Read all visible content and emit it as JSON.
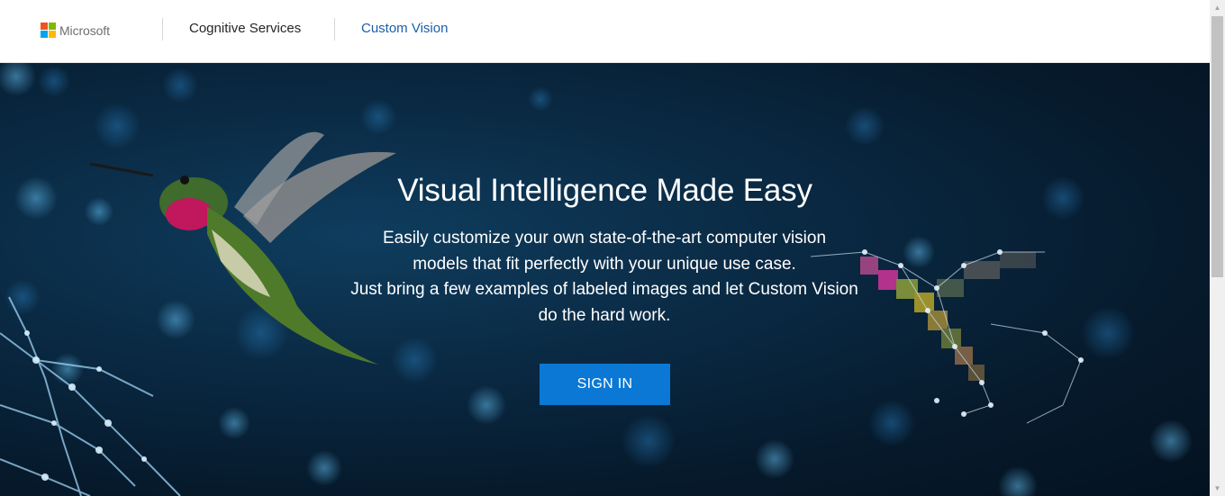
{
  "header": {
    "brand": "Microsoft",
    "nav": [
      {
        "label": "Cognitive Services"
      },
      {
        "label": "Custom Vision"
      }
    ]
  },
  "colors": {
    "ms_red": "#f25022",
    "ms_green": "#7fba00",
    "ms_blue": "#00a4ef",
    "ms_yellow": "#ffb900",
    "accent": "#0a78d4",
    "nav_active": "#1b5ea8",
    "nav_text": "#262626"
  },
  "hero": {
    "title": "Visual Intelligence Made Easy",
    "description_lines": [
      "Easily customize your own state-of-the-art computer vision",
      "models that fit perfectly with your unique use case.",
      "Just bring a few examples of labeled images and let Custom Vision",
      "do the hard work."
    ],
    "cta_label": "SIGN IN"
  }
}
